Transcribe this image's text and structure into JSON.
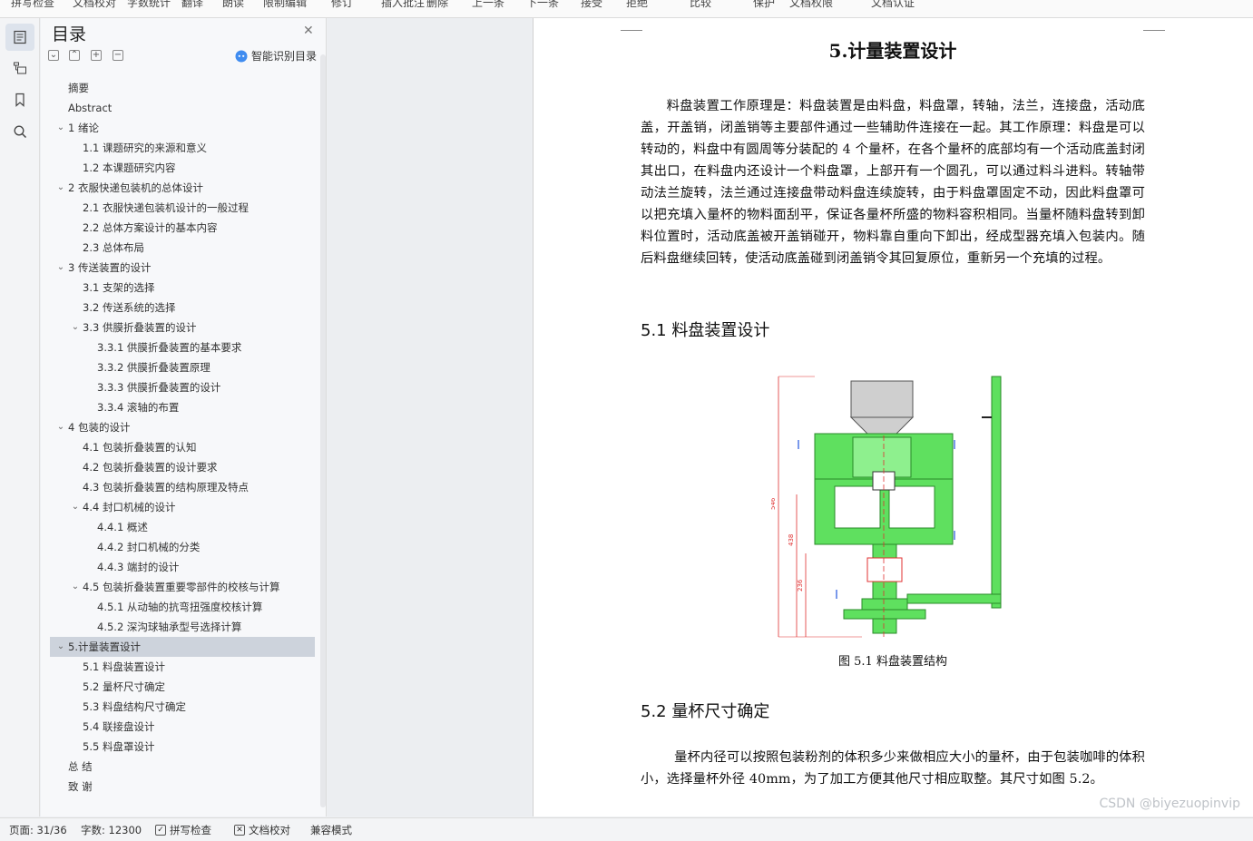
{
  "toolbar": {
    "items": [
      "拼写检查",
      "文档校对",
      "字数统计",
      "翻译",
      "朗读",
      "限制编辑",
      "修订",
      "插入批注",
      "删除",
      "上一条",
      "下一条",
      "接受",
      "拒绝",
      "比较",
      "保护",
      "文档权限",
      "文档认证"
    ]
  },
  "leftbar": {
    "icons": [
      "outline-icon",
      "navigation-icon",
      "bookmark-icon",
      "search-icon"
    ]
  },
  "toc": {
    "title": "目录",
    "smart_label": "智能识别目录",
    "items": [
      {
        "label": "摘要",
        "level": 0,
        "chev": false
      },
      {
        "label": "Abstract",
        "level": 0,
        "chev": false
      },
      {
        "label": "1  绪论",
        "level": 0,
        "chev": true
      },
      {
        "label": "1.1 课题研究的来源和意义",
        "level": 1,
        "chev": false
      },
      {
        "label": "1.2 本课题研究内容",
        "level": 1,
        "chev": false
      },
      {
        "label": "2  衣服快递包装机的总体设计",
        "level": 0,
        "chev": true
      },
      {
        "label": "2.1 衣服快递包装机设计的一般过程",
        "level": 1,
        "chev": false
      },
      {
        "label": "2.2  总体方案设计的基本内容",
        "level": 1,
        "chev": false
      },
      {
        "label": "2.3 总体布局",
        "level": 1,
        "chev": false
      },
      {
        "label": "3  传送装置的设计",
        "level": 0,
        "chev": true
      },
      {
        "label": "3.1 支架的选择",
        "level": 1,
        "chev": false
      },
      {
        "label": "3.2 传送系统的选择",
        "level": 1,
        "chev": false
      },
      {
        "label": "3.3  供膜折叠装置的设计",
        "level": 1,
        "chev": true
      },
      {
        "label": "3.3.1 供膜折叠装置的基本要求",
        "level": 2,
        "chev": false
      },
      {
        "label": "3.3.2 供膜折叠装置原理",
        "level": 2,
        "chev": false
      },
      {
        "label": "3.3.3 供膜折叠装置的设计",
        "level": 2,
        "chev": false
      },
      {
        "label": "3.3.4 滚轴的布置",
        "level": 2,
        "chev": false
      },
      {
        "label": "4  包装的设计",
        "level": 0,
        "chev": true
      },
      {
        "label": "4.1 包装折叠装置的认知",
        "level": 1,
        "chev": false
      },
      {
        "label": "4.2 包装折叠装置的设计要求",
        "level": 1,
        "chev": false
      },
      {
        "label": "4.3 包装折叠装置的结构原理及特点",
        "level": 1,
        "chev": false
      },
      {
        "label": "4.4 封口机械的设计",
        "level": 1,
        "chev": true
      },
      {
        "label": "4.4.1  概述",
        "level": 2,
        "chev": false
      },
      {
        "label": "4.4.2  封口机械的分类",
        "level": 2,
        "chev": false
      },
      {
        "label": "4.4.3  端封的设计",
        "level": 2,
        "chev": false
      },
      {
        "label": "4.5  包装折叠装置重要零部件的校核与计算",
        "level": 1,
        "chev": true
      },
      {
        "label": "4.5.1  从动轴的抗弯扭强度校核计算",
        "level": 2,
        "chev": false
      },
      {
        "label": "4.5.2 深沟球轴承型号选择计算",
        "level": 2,
        "chev": false
      },
      {
        "label": "5.计量装置设计",
        "level": 0,
        "chev": true,
        "selected": true
      },
      {
        "label": "5.1 料盘装置设计",
        "level": 1,
        "chev": false
      },
      {
        "label": "5.2 量杯尺寸确定",
        "level": 1,
        "chev": false
      },
      {
        "label": "5.3 料盘结构尺寸确定",
        "level": 1,
        "chev": false
      },
      {
        "label": "5.4 联接盘设计",
        "level": 1,
        "chev": false
      },
      {
        "label": "5.5 料盘罩设计",
        "level": 1,
        "chev": false
      },
      {
        "label": "总  结",
        "level": 0,
        "chev": false
      },
      {
        "label": "致  谢",
        "level": 0,
        "chev": false
      }
    ]
  },
  "document": {
    "heading": "5.计量装置设计",
    "paragraph1": "料盘装置工作原理是：料盘装置是由料盘，料盘罩，转轴，法兰，连接盘，活动底盖，开盖销，闭盖销等主要部件通过一些辅助件连接在一起。其工作原理：料盘是可以转动的，料盘中有圆周等分装配的 4 个量杯，在各个量杯的底部均有一个活动底盖封闭其出口，在料盘内还设计一个料盘罩，上部开有一个圆孔，可以通过料斗进料。转轴带动法兰旋转，法兰通过连接盘带动料盘连续旋转，由于料盘罩固定不动，因此料盘罩可以把充填入量杯的物料面刮平，保证各量杯所盛的物料容积相同。当量杯随料盘转到卸料位置时，活动底盖被开盖销碰开，物料靠自重向下卸出，经成型器充填入包装内。随后料盘继续回转，使活动底盖碰到闭盖销令其回复原位，重新另一个充填的过程。",
    "section1": "5.1 料盘装置设计",
    "figure_dims": [
      "546",
      "438",
      "236"
    ],
    "caption": "图 5.1 料盘装置结构",
    "section2": "5.2 量杯尺寸确定",
    "paragraph2": "量杯内径可以按照包装粉剂的体积多少来做相应大小的量杯，由于包装咖啡的体积小，选择量杯外径 40mm，为了加工方便其他尺寸相应取整。其尺寸如图 5.2。"
  },
  "watermark": "CSDN @biyezuopinvip",
  "status": {
    "page": "页面: 31/36",
    "words": "字数: 12300",
    "spell": "拼写检查",
    "proof": "文档校对",
    "compat": "兼容模式"
  },
  "colors": {
    "selected_bg": "#cdd3dc",
    "figure_green": "#5fe05f",
    "figure_red": "#e03030"
  }
}
